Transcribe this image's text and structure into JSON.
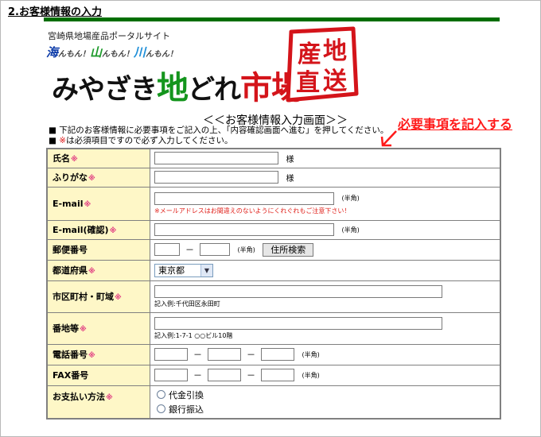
{
  "section_title": "2.お客様情報の入力",
  "header": {
    "portal_subtitle": "宮崎県地場産品ポータルサイト",
    "tagline": [
      {
        "text": "海",
        "style": "umi"
      },
      {
        "text": "んもん！",
        "style": "small"
      },
      {
        "text": "山",
        "style": "yama"
      },
      {
        "text": "んもん！",
        "style": "small"
      },
      {
        "text": "川",
        "style": "kawa"
      },
      {
        "text": "んもん！",
        "style": "small"
      }
    ],
    "logo_parts": [
      {
        "text": "みやざき",
        "style": "c1"
      },
      {
        "text": "地",
        "style": "c2"
      },
      {
        "text": "どれ",
        "style": "c1"
      },
      {
        "text": "市場",
        "style": "c3"
      }
    ],
    "seal_text": "産地直送",
    "seal_color": "#d4141a"
  },
  "form": {
    "heading": "＜＜お客様情報入力画面＞＞",
    "notes": {
      "line1": "■ 下記のお客様情報に必要事項をご記入の上、「内容確認画面へ進む」を押してください。",
      "line2_prefix": "■ ",
      "line2_mark": "※",
      "line2_rest": "は必須項目ですので必ず入力してください。"
    },
    "annotation": "必要事項を記入する",
    "required_mark": "※",
    "rows": {
      "name": {
        "label": "氏名",
        "suffix": "様",
        "value": ""
      },
      "kana": {
        "label": "ふりがな",
        "suffix": "様",
        "value": ""
      },
      "email": {
        "label": "E-mail",
        "suffix": "(半角)",
        "warning": "※メールアドレスはお間違えのないようにくれぐれもご注意下さい！",
        "value": ""
      },
      "email_confirm": {
        "label": "E-mail(確認)",
        "suffix": "(半角)",
        "value": ""
      },
      "postal": {
        "label": "郵便番号",
        "dash": "－",
        "suffix": "(半角)",
        "button": "住所検索",
        "value1": "",
        "value2": ""
      },
      "prefecture": {
        "label": "都道府県",
        "selected": "東京都"
      },
      "city": {
        "label": "市区町村・町域",
        "example": "記入例:千代田区永田町",
        "value": ""
      },
      "address": {
        "label": "番地等",
        "example": "記入例:1-7-1 ○○ビル10階",
        "value": ""
      },
      "phone": {
        "label": "電話番号",
        "dash": "－",
        "suffix": "(半角)"
      },
      "fax": {
        "label": "FAX番号",
        "dash": "－",
        "suffix": "(半角)"
      },
      "payment": {
        "label": "お支払い方法",
        "options": [
          "代金引換",
          "銀行振込"
        ]
      }
    }
  }
}
